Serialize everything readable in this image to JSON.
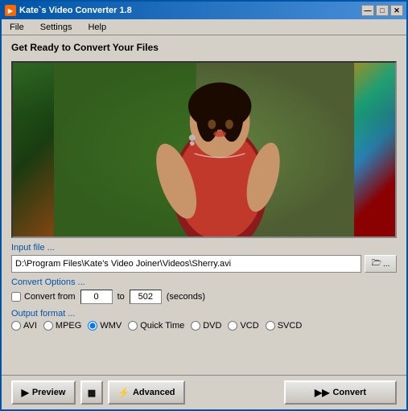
{
  "window": {
    "title": "Kate`s Video Converter 1.8",
    "title_icon": "▶"
  },
  "title_controls": {
    "minimize": "—",
    "maximize": "□",
    "close": "✕"
  },
  "menu": {
    "items": [
      {
        "id": "file",
        "label": "File"
      },
      {
        "id": "settings",
        "label": "Settings"
      },
      {
        "id": "help",
        "label": "Help"
      }
    ]
  },
  "main": {
    "header": "Get Ready to Convert Your Files",
    "input_section_label": "Input file ...",
    "input_value": "D:\\Program Files\\Kate's Video Joiner\\Videos\\Sherry.avi",
    "browse_dots": "...",
    "convert_options_label": "Convert Options ...",
    "convert_from_label": "Convert from",
    "convert_from_value": "0",
    "convert_to_value": "502",
    "convert_to_prefix": "to",
    "seconds_label": "(seconds)",
    "output_format_label": "Output format ...",
    "formats": [
      {
        "id": "avi",
        "label": "AVI",
        "checked": false
      },
      {
        "id": "mpeg",
        "label": "MPEG",
        "checked": false
      },
      {
        "id": "wmv",
        "label": "WMV",
        "checked": true
      },
      {
        "id": "quicktime",
        "label": "Quick Time",
        "checked": false
      },
      {
        "id": "dvd",
        "label": "DVD",
        "checked": false
      },
      {
        "id": "vcd",
        "label": "VCD",
        "checked": false
      },
      {
        "id": "svcd",
        "label": "SVCD",
        "checked": false
      }
    ]
  },
  "buttons": {
    "preview": "Preview",
    "advanced": "Advanced",
    "convert": "Convert"
  },
  "icons": {
    "preview_icon": "▶",
    "advanced_icon": "⚡",
    "convert_icon": "▶▶",
    "grid_icon": "▦",
    "folder_icon": "📁"
  }
}
